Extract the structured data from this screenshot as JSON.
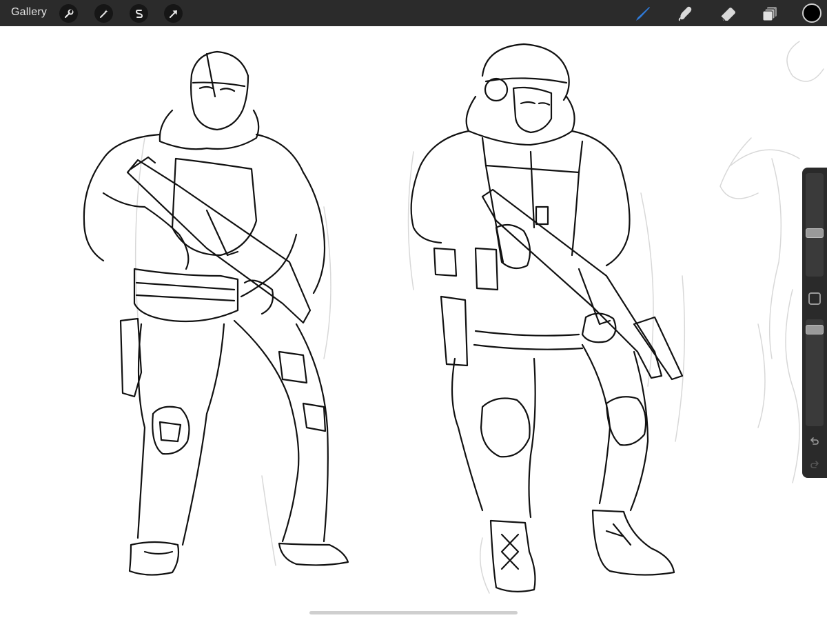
{
  "app": {
    "gallery_label": "Gallery"
  },
  "toolbar": {
    "left_tools": [
      {
        "name": "actions",
        "icon": "wrench-icon"
      },
      {
        "name": "adjustments",
        "icon": "magic-wand-icon"
      },
      {
        "name": "selection",
        "icon": "selection-s-icon"
      },
      {
        "name": "transform",
        "icon": "arrow-cursor-icon"
      }
    ],
    "right_tools": [
      {
        "name": "brush",
        "icon": "brush-icon",
        "active": true
      },
      {
        "name": "smudge",
        "icon": "smudge-icon",
        "active": false
      },
      {
        "name": "eraser",
        "icon": "eraser-icon",
        "active": false
      },
      {
        "name": "layers",
        "icon": "layers-icon",
        "active": false
      }
    ],
    "current_color": "#000000",
    "accent_color": "#2f7ad8"
  },
  "sidebar": {
    "brush_size_level": 0.3,
    "opacity_level": 0.1,
    "buttons": [
      {
        "name": "modify",
        "icon": "square-icon"
      },
      {
        "name": "undo",
        "icon": "undo-icon"
      },
      {
        "name": "redo",
        "icon": "redo-icon"
      }
    ]
  }
}
